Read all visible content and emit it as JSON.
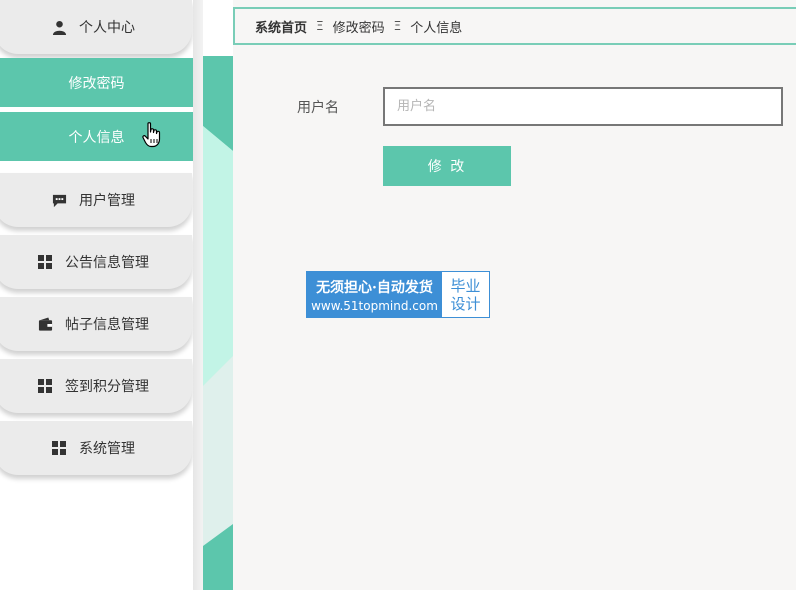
{
  "sidebar": {
    "items": [
      {
        "label": "个人中心",
        "icon": "user-icon"
      },
      {
        "label": "用户管理",
        "icon": "chat-icon"
      },
      {
        "label": "公告信息管理",
        "icon": "grid-icon"
      },
      {
        "label": "帖子信息管理",
        "icon": "wallet-icon"
      },
      {
        "label": "签到积分管理",
        "icon": "grid-icon"
      },
      {
        "label": "系统管理",
        "icon": "grid-icon"
      }
    ],
    "sub_items": [
      {
        "label": "修改密码"
      },
      {
        "label": "个人信息"
      }
    ]
  },
  "breadcrumb": {
    "home": "系统首页",
    "items": [
      "修改密码",
      "个人信息"
    ],
    "separator": "Ξ"
  },
  "form": {
    "username_label": "用户名",
    "username_placeholder": "用户名",
    "username_value": "",
    "submit_label": "修 改"
  },
  "watermark": {
    "line1": "无须担心·自动发货",
    "line2": "www.51topmind.com",
    "right_line1": "毕业",
    "right_line2": "设计"
  },
  "colors": {
    "accent": "#5cc6ac",
    "breadcrumb_border": "#79cdb7",
    "watermark_blue": "#3d8fd6"
  }
}
